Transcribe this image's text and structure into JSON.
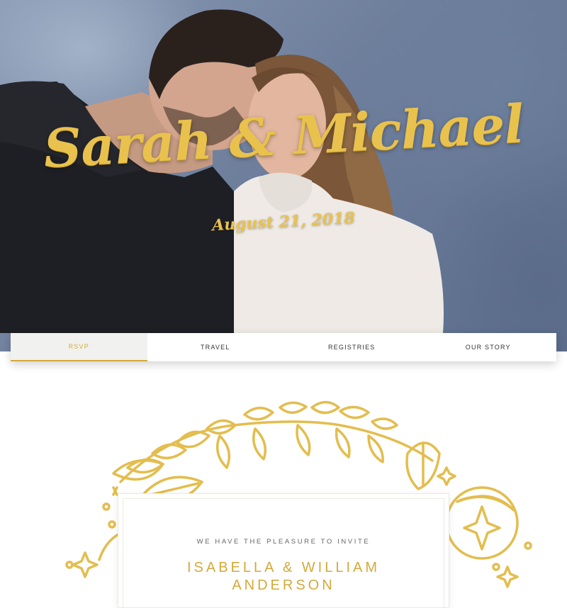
{
  "hero": {
    "title": "Sarah & Michael",
    "date": "August 21, 2018"
  },
  "nav": {
    "items": [
      {
        "label": "RSVP",
        "active": true
      },
      {
        "label": "TRAVEL",
        "active": false
      },
      {
        "label": "REGISTRIES",
        "active": false
      },
      {
        "label": "OUR STORY",
        "active": false
      }
    ]
  },
  "invitation": {
    "intro": "WE HAVE THE PLEASURE TO INVITE",
    "name": "ISABELLA & WILLIAM ANDERSON"
  },
  "colors": {
    "accent_gold": "#d4a93a",
    "nav_active_bg": "#f1f2f0",
    "hero_backdrop": "#6e7f9c"
  }
}
